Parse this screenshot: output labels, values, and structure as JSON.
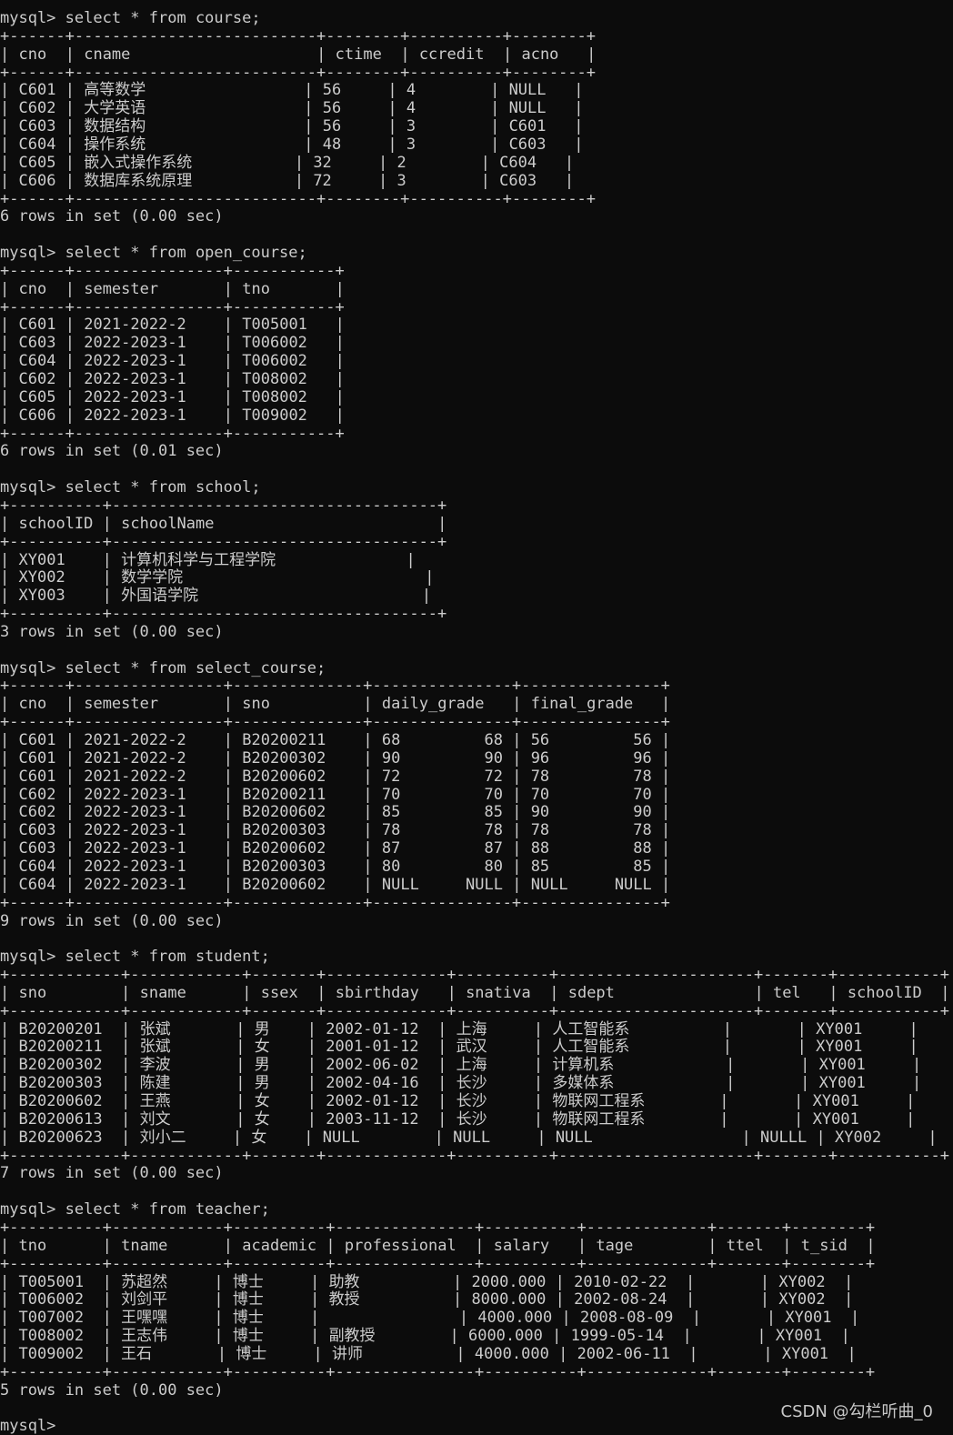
{
  "session": {
    "prompt": "mysql> ",
    "last_prompt": "mysql> ",
    "blocks": [
      {
        "command": "select * from course;",
        "columns": [
          "cno",
          "cname",
          "ctime",
          "ccredit",
          "acno"
        ],
        "widths": [
          6,
          26,
          8,
          10,
          8
        ],
        "align": [
          "l",
          "l",
          "l",
          "l",
          "l"
        ],
        "rows": [
          [
            "C601",
            "高等数学",
            "56",
            "4",
            "NULL"
          ],
          [
            "C602",
            "大学英语",
            "56",
            "4",
            "NULL"
          ],
          [
            "C603",
            "数据结构",
            "56",
            "3",
            "C601"
          ],
          [
            "C604",
            "操作系统",
            "48",
            "3",
            "C603"
          ],
          [
            "C605",
            "嵌入式操作系统",
            "32",
            "2",
            "C604"
          ],
          [
            "C606",
            "数据库系统原理",
            "72",
            "3",
            "C603"
          ]
        ],
        "footer": "6 rows in set (0.00 sec)"
      },
      {
        "command": "select * from open_course;",
        "columns": [
          "cno",
          "semester",
          "tno"
        ],
        "widths": [
          6,
          16,
          11
        ],
        "align": [
          "l",
          "l",
          "l"
        ],
        "rows": [
          [
            "C601",
            "2021-2022-2",
            "T005001"
          ],
          [
            "C603",
            "2022-2023-1",
            "T006002"
          ],
          [
            "C604",
            "2022-2023-1",
            "T006002"
          ],
          [
            "C602",
            "2022-2023-1",
            "T008002"
          ],
          [
            "C605",
            "2022-2023-1",
            "T008002"
          ],
          [
            "C606",
            "2022-2023-1",
            "T009002"
          ]
        ],
        "footer": "6 rows in set (0.01 sec)"
      },
      {
        "command": "select * from school;",
        "columns": [
          "schoolID",
          "schoolName"
        ],
        "widths": [
          10,
          35
        ],
        "align": [
          "l",
          "l"
        ],
        "rows": [
          [
            "XY001",
            "计算机科学与工程学院"
          ],
          [
            "XY002",
            "数学学院"
          ],
          [
            "XY003",
            "外国语学院"
          ]
        ],
        "footer": "3 rows in set (0.00 sec)"
      },
      {
        "command": "select * from select_course;",
        "columns": [
          "cno",
          "semester",
          "sno",
          "daily_grade",
          "final_grade"
        ],
        "widths": [
          6,
          16,
          14,
          15,
          15
        ],
        "align": [
          "l",
          "l",
          "l",
          "r",
          "r"
        ],
        "rows": [
          [
            "C601",
            "2021-2022-2",
            "B20200211",
            "68",
            "56"
          ],
          [
            "C601",
            "2021-2022-2",
            "B20200302",
            "90",
            "96"
          ],
          [
            "C601",
            "2021-2022-2",
            "B20200602",
            "72",
            "78"
          ],
          [
            "C602",
            "2022-2023-1",
            "B20200211",
            "70",
            "70"
          ],
          [
            "C602",
            "2022-2023-1",
            "B20200602",
            "85",
            "90"
          ],
          [
            "C603",
            "2022-2023-1",
            "B20200303",
            "78",
            "78"
          ],
          [
            "C603",
            "2022-2023-1",
            "B20200602",
            "87",
            "88"
          ],
          [
            "C604",
            "2022-2023-1",
            "B20200303",
            "80",
            "85"
          ],
          [
            "C604",
            "2022-2023-1",
            "B20200602",
            "NULL",
            "NULL"
          ]
        ],
        "footer": "9 rows in set (0.00 sec)"
      },
      {
        "command": "select * from student;",
        "columns": [
          "sno",
          "sname",
          "ssex",
          "sbirthday",
          "snativa",
          "sdept",
          "tel",
          "schoolID"
        ],
        "widths": [
          12,
          12,
          7,
          13,
          10,
          21,
          7,
          11
        ],
        "align": [
          "l",
          "l",
          "l",
          "l",
          "l",
          "l",
          "r",
          "l"
        ],
        "rows": [
          [
            "B20200201",
            "张斌",
            "男",
            "2002-01-12",
            "上海",
            "人工智能系",
            "",
            "XY001"
          ],
          [
            "B20200211",
            "张斌",
            "女",
            "2001-01-12",
            "武汉",
            "人工智能系",
            "",
            "XY001"
          ],
          [
            "B20200302",
            "李波",
            "男",
            "2002-06-02",
            "上海",
            "计算机系",
            "",
            "XY001"
          ],
          [
            "B20200303",
            "陈建",
            "男",
            "2002-04-16",
            "长沙",
            "多媒体系",
            "",
            "XY001"
          ],
          [
            "B20200602",
            "王燕",
            "女",
            "2002-01-12",
            "长沙",
            "物联网工程系",
            "",
            "XY001"
          ],
          [
            "B20200613",
            "刘文",
            "女",
            "2003-11-12",
            "长沙",
            "物联网工程系",
            "",
            "XY001"
          ],
          [
            "B20200623",
            "刘小二",
            "女",
            "NULL",
            "NULL",
            "NULL",
            "NULL",
            "XY002"
          ]
        ],
        "footer": "7 rows in set (0.00 sec)"
      },
      {
        "command": "select * from teacher;",
        "columns": [
          "tno",
          "tname",
          "academic",
          "professional",
          "salary",
          "tage",
          "ttel",
          "t_sid"
        ],
        "widths": [
          10,
          12,
          10,
          15,
          10,
          13,
          7,
          8
        ],
        "align": [
          "l",
          "l",
          "l",
          "l",
          "r",
          "l",
          "l",
          "l"
        ],
        "rows": [
          [
            "T005001",
            "苏超然",
            "博士",
            "助教",
            "2000.00",
            "2010-02-22",
            "",
            "XY002"
          ],
          [
            "T006002",
            "刘剑平",
            "博士",
            "教授",
            "8000.00",
            "2002-08-24",
            "",
            "XY002"
          ],
          [
            "T007002",
            "王嘿嘿",
            "博士",
            "",
            "4000.00",
            "2008-08-09",
            "",
            "XY001"
          ],
          [
            "T008002",
            "王志伟",
            "博士",
            "副教授",
            "6000.00",
            "1999-05-14",
            "",
            "XY001"
          ],
          [
            "T009002",
            "王石",
            "博士",
            "讲师",
            "4000.00",
            "2002-06-11",
            "",
            "XY001"
          ]
        ],
        "footer": "5 rows in set (0.00 sec)"
      }
    ]
  },
  "watermark": "CSDN @勾栏听曲_0",
  "colors": {
    "background": "#0c0c0c",
    "text": "#cccccc"
  }
}
